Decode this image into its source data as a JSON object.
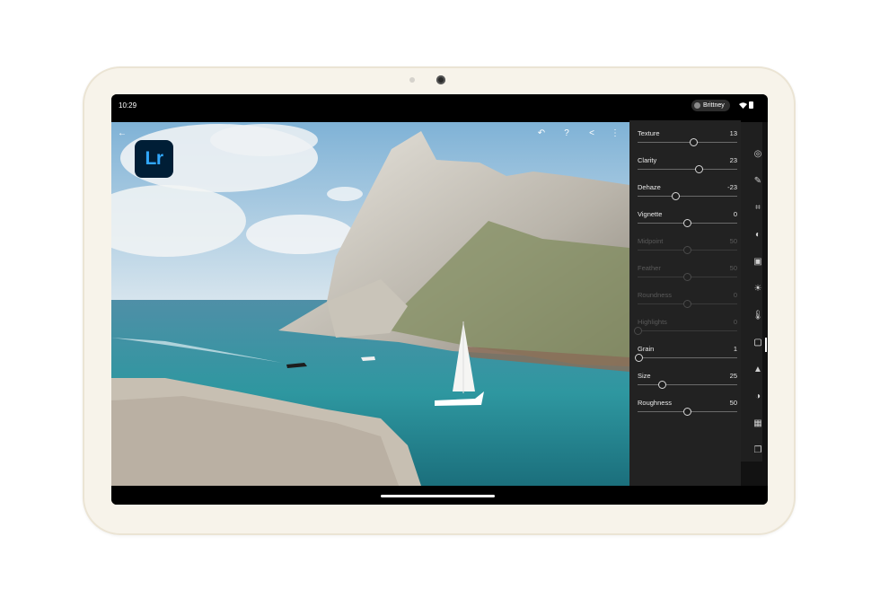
{
  "status_bar": {
    "time": "10:29",
    "user": "Brittney",
    "icons": [
      "wifi-icon",
      "battery-icon"
    ]
  },
  "app": {
    "logo_text": "Lr",
    "top_icons": [
      "back-arrow-icon",
      "undo-icon",
      "help-icon",
      "share-icon",
      "more-icon"
    ]
  },
  "sliders": [
    {
      "label": "Texture",
      "value": "13",
      "fraction": 0.565,
      "enabled": true
    },
    {
      "label": "Clarity",
      "value": "23",
      "fraction": 0.615,
      "enabled": true
    },
    {
      "label": "Dehaze",
      "value": "-23",
      "fraction": 0.385,
      "enabled": true
    },
    {
      "label": "Vignette",
      "value": "0",
      "fraction": 0.5,
      "enabled": true
    },
    {
      "label": "Midpoint",
      "value": "50",
      "fraction": 0.5,
      "enabled": false
    },
    {
      "label": "Feather",
      "value": "50",
      "fraction": 0.5,
      "enabled": false
    },
    {
      "label": "Roundness",
      "value": "0",
      "fraction": 0.5,
      "enabled": false
    },
    {
      "label": "Highlights",
      "value": "0",
      "fraction": 0.0,
      "enabled": false
    },
    {
      "label": "Grain",
      "value": "1",
      "fraction": 0.01,
      "enabled": true
    },
    {
      "label": "Size",
      "value": "25",
      "fraction": 0.25,
      "enabled": true
    },
    {
      "label": "Roughness",
      "value": "50",
      "fraction": 0.5,
      "enabled": true
    }
  ],
  "tools": [
    "presets-icon",
    "healing-icon",
    "crop-icon",
    "masking-icon",
    "profile-icon",
    "light-icon",
    "color-icon",
    "effects-icon",
    "detail-icon",
    "optics-icon",
    "geometry-icon",
    "versions-icon"
  ],
  "active_tool": "effects-icon",
  "colors": {
    "logo_bg": "#001e36",
    "logo_fg": "#31a8ff",
    "panel_bg": "#222222"
  }
}
